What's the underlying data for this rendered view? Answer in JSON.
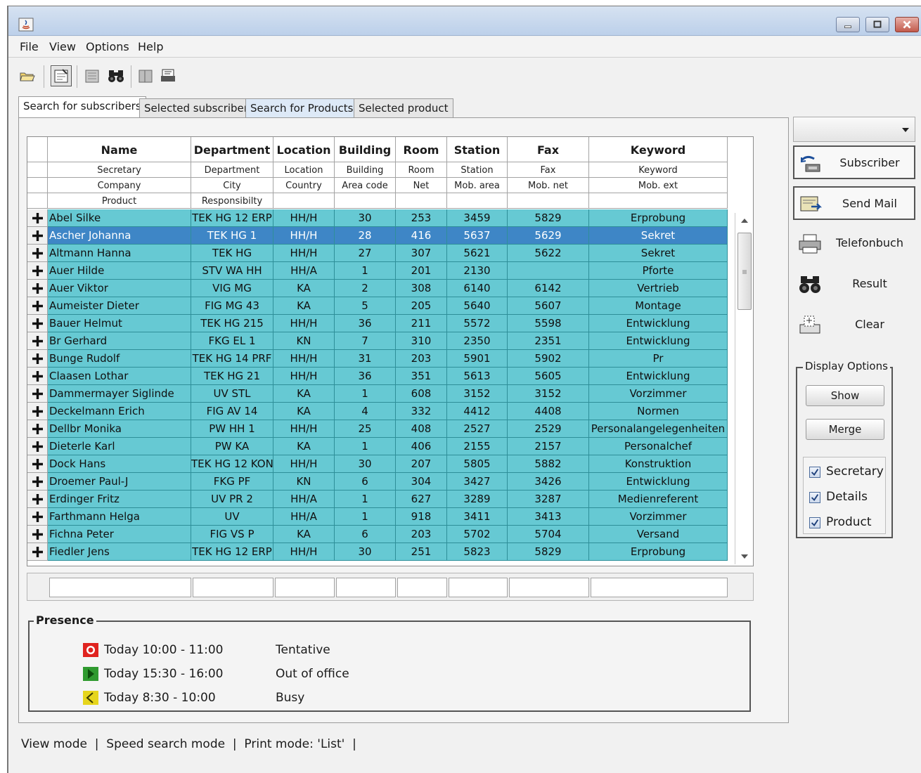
{
  "menu": [
    "File",
    "View",
    "Options",
    "Help"
  ],
  "tabs": [
    {
      "label": "Search for subscribers",
      "selected": true
    },
    {
      "label": "Selected subscriber",
      "selected": false
    },
    {
      "label": "Search for Products",
      "selected": false
    },
    {
      "label": "Selected product",
      "selected": false
    }
  ],
  "table": {
    "headers": [
      {
        "main": "Name",
        "sub": [
          "",
          "Secretary",
          "Company",
          "Product"
        ]
      },
      {
        "main": "Department",
        "sub": [
          "",
          "Department",
          "City",
          "Responsibilty"
        ]
      },
      {
        "main": "Location",
        "sub": [
          "",
          "Location",
          "Country",
          ""
        ]
      },
      {
        "main": "Building",
        "sub": [
          "",
          "Building",
          "Area code",
          ""
        ]
      },
      {
        "main": "Room",
        "sub": [
          "",
          "Room",
          "Net",
          ""
        ]
      },
      {
        "main": "Station",
        "sub": [
          "",
          "Station",
          "Mob. area",
          ""
        ]
      },
      {
        "main": "Fax",
        "sub": [
          "",
          "Fax",
          "Mob. net",
          ""
        ]
      },
      {
        "main": "Keyword",
        "sub": [
          "",
          "Keyword",
          "Mob. ext",
          ""
        ]
      }
    ],
    "selected_row": 1,
    "rows": [
      [
        "Abel Silke",
        "TEK HG 12 ERP",
        "HH/H",
        "30",
        "253",
        "3459",
        "5829",
        "Erprobung"
      ],
      [
        "Ascher Johanna",
        "TEK HG 1",
        "HH/H",
        "28",
        "416",
        "5637",
        "5629",
        "Sekret"
      ],
      [
        "Altmann Hanna",
        "TEK HG",
        "HH/H",
        "27",
        "307",
        "5621",
        "5622",
        "Sekret"
      ],
      [
        "Auer Hilde",
        "STV WA HH",
        "HH/A",
        "1",
        "201",
        "2130",
        "",
        "Pforte"
      ],
      [
        "Auer Viktor",
        "VIG MG",
        "KA",
        "2",
        "308",
        "6140",
        "6142",
        "Vertrieb"
      ],
      [
        "Aumeister Dieter",
        "FIG MG 43",
        "KA",
        "5",
        "205",
        "5640",
        "5607",
        "Montage"
      ],
      [
        "Bauer Helmut",
        "TEK HG 215",
        "HH/H",
        "36",
        "211",
        "5572",
        "5598",
        "Entwicklung"
      ],
      [
        "Br Gerhard",
        "FKG EL 1",
        "KN",
        "7",
        "310",
        "2350",
        "2351",
        "Entwicklung"
      ],
      [
        "Bunge Rudolf",
        "TEK HG 14 PRF",
        "HH/H",
        "31",
        "203",
        "5901",
        "5902",
        "Pr"
      ],
      [
        "Claasen Lothar",
        "TEK HG 21",
        "HH/H",
        "36",
        "351",
        "5613",
        "5605",
        "Entwicklung"
      ],
      [
        "Dammermayer Siglinde",
        "UV STL",
        "KA",
        "1",
        "608",
        "3152",
        "3152",
        "Vorzimmer"
      ],
      [
        "Deckelmann Erich",
        "FIG AV 14",
        "KA",
        "4",
        "332",
        "4412",
        "4408",
        "Normen"
      ],
      [
        "Dellbr Monika",
        "PW HH 1",
        "HH/H",
        "25",
        "408",
        "2527",
        "2529",
        "Personalangelegenheiten"
      ],
      [
        "Dieterle Karl",
        "PW KA",
        "KA",
        "1",
        "406",
        "2155",
        "2157",
        "Personalchef"
      ],
      [
        "Dock Hans",
        "TEK HG 12 KON",
        "HH/H",
        "30",
        "207",
        "5805",
        "5882",
        "Konstruktion"
      ],
      [
        "Droemer Paul-J",
        "FKG PF",
        "KN",
        "6",
        "304",
        "3427",
        "3426",
        "Entwicklung"
      ],
      [
        "Erdinger Fritz",
        "UV PR 2",
        "HH/A",
        "1",
        "627",
        "3289",
        "3287",
        "Medienreferent"
      ],
      [
        "Farthmann Helga",
        "UV",
        "HH/A",
        "1",
        "918",
        "3411",
        "3413",
        "Vorzimmer"
      ],
      [
        "Fichna Peter",
        "FIG VS P",
        "KA",
        "6",
        "203",
        "5702",
        "5704",
        "Versand"
      ],
      [
        "Fiedler Jens",
        "TEK HG 12 ERP",
        "HH/H",
        "30",
        "251",
        "5823",
        "5829",
        "Erprobung"
      ]
    ]
  },
  "presence": {
    "title": "Presence",
    "items": [
      {
        "time": "Today 10:00 - 11:00",
        "status": "Tentative",
        "icon": "tentative-icon",
        "color": "#e0231f"
      },
      {
        "time": "Today 15:30 - 16:00",
        "status": "Out of office",
        "icon": "out-of-office-icon",
        "color": "#2f9a2f"
      },
      {
        "time": "Today 8:30 - 10:00",
        "status": "Busy",
        "icon": "busy-icon",
        "color": "#e6d51c"
      }
    ]
  },
  "status_bar": "View mode  |  Speed search mode  |  Print mode: 'List'  |",
  "side": {
    "combo_value": "",
    "actions": [
      {
        "label": "Subscriber",
        "icon": "subscriber-icon"
      },
      {
        "label": "Send Mail",
        "icon": "send-mail-icon"
      },
      {
        "label": "Telefonbuch",
        "icon": "printer-icon"
      },
      {
        "label": "Result",
        "icon": "binoculars-icon"
      },
      {
        "label": "Clear",
        "icon": "clear-icon"
      }
    ],
    "display_options": {
      "title": "Display Options",
      "show_label": "Show",
      "merge_label": "Merge",
      "checkboxes": [
        {
          "label": "Secretary",
          "checked": true
        },
        {
          "label": "Details",
          "checked": true
        },
        {
          "label": "Product",
          "checked": true
        }
      ]
    }
  },
  "colors": {
    "row_bg": "#66c9d3",
    "selected_row_bg": "#3e86c6"
  }
}
